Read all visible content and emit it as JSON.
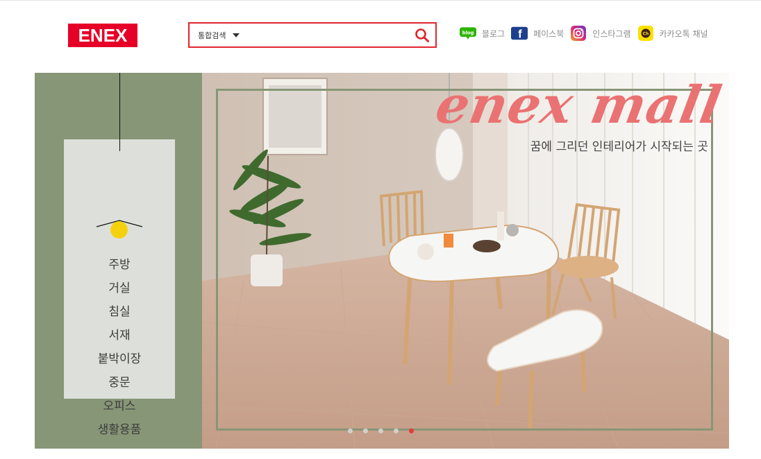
{
  "logo": {
    "text": "ENEX",
    "color": "#e60028"
  },
  "search": {
    "category_label": "통합검색",
    "value": "",
    "placeholder": "",
    "accent": "#e0252b"
  },
  "social": [
    {
      "icon": "blog-icon",
      "label": "블로그"
    },
    {
      "icon": "facebook-icon",
      "label": "페이스북"
    },
    {
      "icon": "instagram-icon",
      "label": "인스타그램"
    },
    {
      "icon": "kakao-channel-icon",
      "label": "카카오톡 채널"
    }
  ],
  "categories": [
    "주방",
    "거실",
    "침실",
    "서재",
    "붙박이장",
    "중문",
    "오피스",
    "생활용품"
  ],
  "banner": {
    "title": "enex mall",
    "subtitle": "꿈에 그리던 인테리어가 시작되는 곳",
    "slide_count": 5,
    "active_slide": 5
  },
  "colors": {
    "panel_green": "#879676",
    "card_bg": "#dde0da",
    "bulb": "#f5d10d",
    "title_pink": "#ea7272"
  }
}
